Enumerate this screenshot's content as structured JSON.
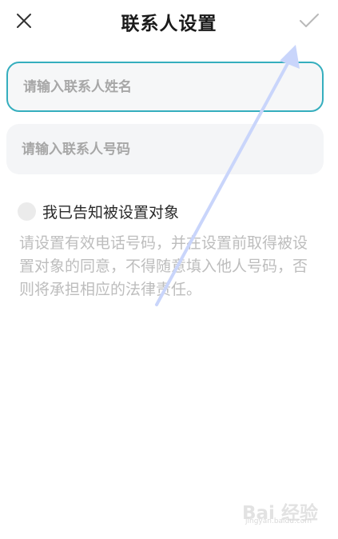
{
  "header": {
    "title": "联系人设置"
  },
  "form": {
    "name_placeholder": "请输入联系人姓名",
    "phone_placeholder": "请输入联系人号码"
  },
  "consent": {
    "label": "我已告知被设置对象",
    "checked": false
  },
  "disclaimer": "请设置有效电话号码，并在设置前取得被设置对象的同意，不得随意填入他人号码，否则将承担相应的法律责任。",
  "colors": {
    "focus_border": "#35aebe",
    "field_bg": "#f4f5f7",
    "hint_text": "#bdbdbd",
    "arrow": "#c9d5fb"
  },
  "watermark": {
    "logo": "Bai 经验",
    "url": "jingyan.baidu.com"
  }
}
